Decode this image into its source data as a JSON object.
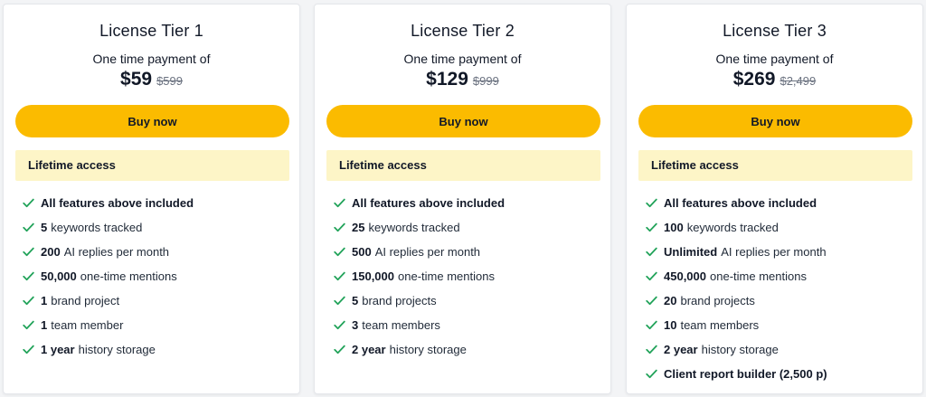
{
  "theme": {
    "accent": "#fbbb00",
    "banner_bg": "#fdf5c7",
    "check_color": "#22a35a"
  },
  "tiers": [
    {
      "title": "License Tier 1",
      "subtitle": "One time payment of",
      "price": "$59",
      "old_price": "$599",
      "button_label": "Buy now",
      "access_label": "Lifetime access",
      "features": [
        {
          "strong": "All features above included",
          "rest": ""
        },
        {
          "strong": "5",
          "rest": "keywords tracked"
        },
        {
          "strong": "200",
          "rest": "AI replies per month"
        },
        {
          "strong": "50,000",
          "rest": "one-time mentions"
        },
        {
          "strong": "1",
          "rest": "brand project"
        },
        {
          "strong": "1",
          "rest": "team member"
        },
        {
          "strong": "1 year",
          "rest": "history storage"
        }
      ]
    },
    {
      "title": "License Tier 2",
      "subtitle": "One time payment of",
      "price": "$129",
      "old_price": "$999",
      "button_label": "Buy now",
      "access_label": "Lifetime access",
      "features": [
        {
          "strong": "All features above included",
          "rest": ""
        },
        {
          "strong": "25",
          "rest": "keywords tracked"
        },
        {
          "strong": "500",
          "rest": "AI replies per month"
        },
        {
          "strong": "150,000",
          "rest": "one-time mentions"
        },
        {
          "strong": "5",
          "rest": "brand projects"
        },
        {
          "strong": "3",
          "rest": "team members"
        },
        {
          "strong": "2 year",
          "rest": "history storage"
        }
      ]
    },
    {
      "title": "License Tier 3",
      "subtitle": "One time payment of",
      "price": "$269",
      "old_price": "$2,499",
      "button_label": "Buy now",
      "access_label": "Lifetime access",
      "features": [
        {
          "strong": "All features above included",
          "rest": ""
        },
        {
          "strong": "100",
          "rest": "keywords tracked"
        },
        {
          "strong": "Unlimited",
          "rest": "AI replies per month"
        },
        {
          "strong": "450,000",
          "rest": "one-time mentions"
        },
        {
          "strong": "20",
          "rest": "brand projects"
        },
        {
          "strong": "10",
          "rest": "team members"
        },
        {
          "strong": "2 year",
          "rest": "history storage"
        },
        {
          "strong": "Client report builder (2,500 p)",
          "rest": ""
        }
      ]
    }
  ]
}
